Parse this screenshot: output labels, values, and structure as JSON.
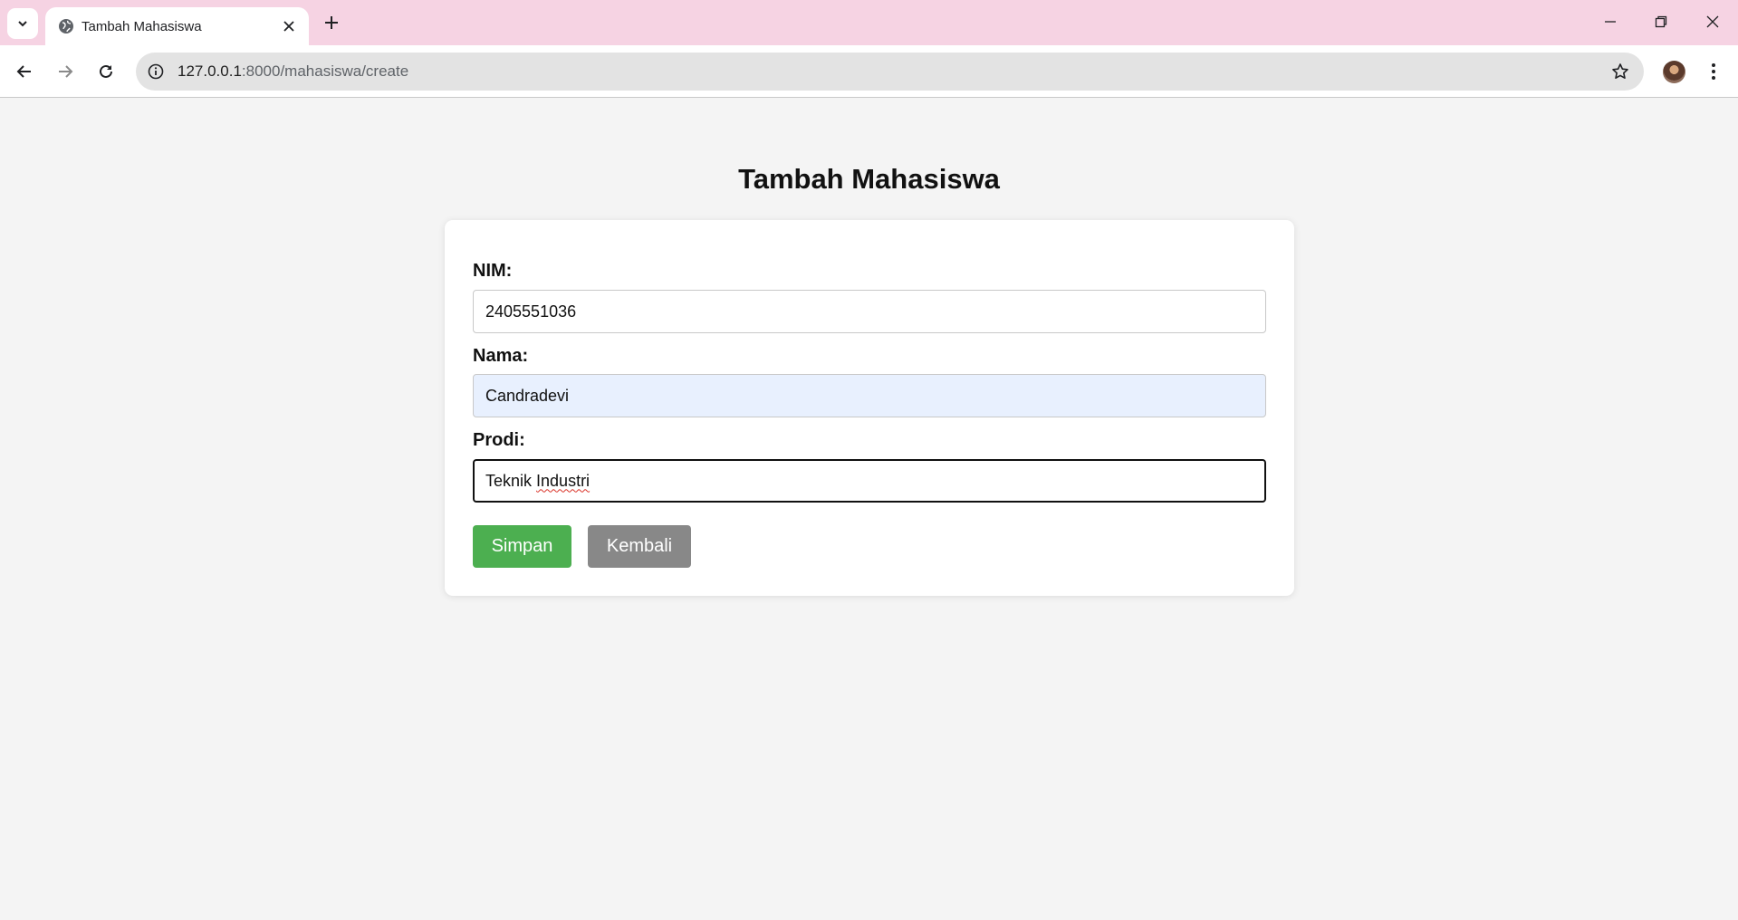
{
  "browser": {
    "tab": {
      "title": "Tambah Mahasiswa",
      "favicon": "globe-icon"
    },
    "address": {
      "host": "127.0.0.1",
      "rest": ":8000/mahasiswa/create"
    },
    "colors": {
      "tabbar": "#f6d3e3",
      "omnibox": "#e3e3e3"
    }
  },
  "page": {
    "title": "Tambah Mahasiswa",
    "form": {
      "nim": {
        "label": "NIM:",
        "value": "2405551036"
      },
      "nama": {
        "label": "Nama:",
        "value": "Candradevi"
      },
      "prodi": {
        "label": "Prodi:",
        "value_word1": "Teknik ",
        "value_word2": "Industri"
      }
    },
    "buttons": {
      "save": "Simpan",
      "back": "Kembali"
    },
    "colors": {
      "save": "#4caf50",
      "back": "#888888",
      "autofill": "#e8f0fe",
      "background": "#f4f4f4"
    }
  }
}
